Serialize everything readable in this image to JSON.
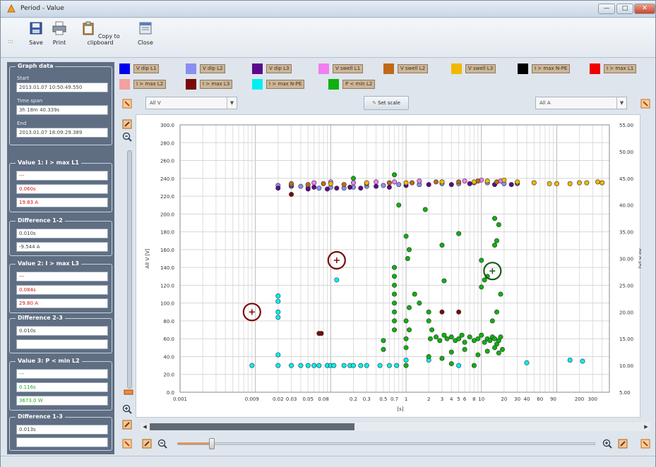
{
  "window": {
    "title": "Period - Value",
    "minimize_label": "—",
    "maximize_label": "□",
    "close_label": "✕"
  },
  "toolbar": {
    "save_label": "Save",
    "print_label": "Print",
    "copy_label": "Copy to clipboard",
    "close_label": "Close"
  },
  "graph_data": {
    "title": "Graph data",
    "start_caption": "Start",
    "start": "2013.01.07 10:50:49.550",
    "timespan_caption": "Time span",
    "timespan": "3h 18m 40.339s",
    "end_caption": "End",
    "end": "2013.01.07 18:09:29.389"
  },
  "value1": {
    "title": "Value 1: I > max L1",
    "v1": "---",
    "v2": "0.060s",
    "v3": "19.83 A"
  },
  "diff12": {
    "title": "Difference 1-2",
    "v1": "0.010s",
    "v2": "-9.544 A"
  },
  "value2": {
    "title": "Value 2: I > max L3",
    "v1": "---",
    "v2": "0.084s",
    "v3": "29.80 A"
  },
  "diff23": {
    "title": "Difference 2-3",
    "v1": "0.010s",
    "v2": ""
  },
  "value3": {
    "title": "Value 3: P < min L2",
    "v1": "---",
    "v2": "0.116s",
    "v3": "3673.0 W"
  },
  "diff13": {
    "title": "Difference 1-3",
    "v1": "0.013s",
    "v2": ""
  },
  "legend": [
    {
      "label": "V dip L1",
      "color": "#0000ee"
    },
    {
      "label": "V dip L2",
      "color": "#8a8ef0"
    },
    {
      "label": "V dip L3",
      "color": "#5a0a8a"
    },
    {
      "label": "V swell L1",
      "color": "#f07ef0"
    },
    {
      "label": "V swell L2",
      "color": "#c06a18"
    },
    {
      "label": "V swell L3",
      "color": "#f0b800"
    },
    {
      "label": "I > max N-PE",
      "color": "#000000"
    },
    {
      "label": "I > max L1",
      "color": "#ee0000"
    },
    {
      "label": "I > max L2",
      "color": "#f4a0a0"
    },
    {
      "label": "I > max L3",
      "color": "#7a0a0a"
    },
    {
      "label": "I > max N-PE",
      "color": "#00f0f0"
    },
    {
      "label": "P < min L2",
      "color": "#10b010"
    }
  ],
  "controls": {
    "left_select": "All V",
    "right_select": "All A",
    "set_scale_label": "Set scale"
  },
  "chart_data": {
    "type": "scatter",
    "xlabel": "[s]",
    "ylabel_left": "All V [V]",
    "ylabel_right": "All A [A]",
    "x_scale": "log",
    "xlim": [
      0.001,
      500
    ],
    "ylim_left": [
      0,
      300
    ],
    "ylim_right": [
      5,
      55
    ],
    "grid": true,
    "x_ticks": [
      "0.001",
      "0.009",
      "0.02",
      "0.03",
      "0.05",
      "0.08",
      "0.2",
      "0.3",
      "0.5",
      "0.7",
      "1",
      "2",
      "3",
      "4",
      "5",
      "6",
      "8",
      "10",
      "20",
      "30",
      "40",
      "60",
      "90",
      "200",
      "300"
    ],
    "x_tick_values": [
      0.001,
      0.009,
      0.02,
      0.03,
      0.05,
      0.08,
      0.2,
      0.3,
      0.5,
      0.7,
      1,
      2,
      3,
      4,
      5,
      6,
      8,
      10,
      20,
      30,
      40,
      60,
      90,
      200,
      300
    ],
    "y_left_ticks": [
      "0.0",
      "20.0",
      "40.0",
      "60.0",
      "80.0",
      "100.0",
      "120.0",
      "140.0",
      "160.0",
      "180.0",
      "200.0",
      "220.0",
      "240.0",
      "260.0",
      "280.0",
      "300.0"
    ],
    "y_left_tick_values": [
      0,
      20,
      40,
      60,
      80,
      100,
      120,
      140,
      160,
      180,
      200,
      220,
      240,
      260,
      280,
      300
    ],
    "y_right_ticks": [
      "5.00",
      "10.00",
      "15.00",
      "20.00",
      "25.00",
      "30.00",
      "35.00",
      "40.00",
      "45.00",
      "50.00",
      "55.00"
    ],
    "y_right_tick_values": [
      5,
      10,
      15,
      20,
      25,
      30,
      35,
      40,
      45,
      50,
      55
    ],
    "series": [
      {
        "name": "V dip L2",
        "color": "#8a8ef0",
        "axis": "left",
        "points": [
          [
            0.02,
            232
          ],
          [
            0.03,
            231
          ],
          [
            0.04,
            231
          ],
          [
            0.05,
            230
          ],
          [
            0.07,
            229
          ],
          [
            0.1,
            230
          ],
          [
            0.15,
            229
          ],
          [
            0.2,
            230
          ],
          [
            0.3,
            231
          ],
          [
            0.5,
            232
          ],
          [
            0.8,
            233
          ],
          [
            1.5,
            233
          ],
          [
            3,
            234
          ],
          [
            5,
            234
          ],
          [
            8,
            235
          ],
          [
            12,
            235
          ],
          [
            20,
            234
          ],
          [
            30,
            234
          ]
        ]
      },
      {
        "name": "V dip L3",
        "color": "#5a0a8a",
        "axis": "left",
        "points": [
          [
            0.02,
            229
          ],
          [
            0.03,
            232
          ],
          [
            0.05,
            228
          ],
          [
            0.06,
            230
          ],
          [
            0.09,
            228
          ],
          [
            0.12,
            229
          ],
          [
            0.18,
            230
          ],
          [
            0.25,
            229
          ],
          [
            0.4,
            231
          ],
          [
            0.6,
            230
          ],
          [
            1,
            232
          ],
          [
            2,
            233
          ],
          [
            4,
            233
          ],
          [
            7,
            234
          ],
          [
            15,
            233
          ],
          [
            25,
            233
          ]
        ]
      },
      {
        "name": "V swell L1",
        "color": "#f07ef0",
        "axis": "left",
        "points": [
          [
            0.03,
            233
          ],
          [
            0.06,
            235
          ],
          [
            0.1,
            236
          ],
          [
            0.2,
            235
          ],
          [
            0.4,
            236
          ],
          [
            0.7,
            236
          ],
          [
            1.5,
            237
          ],
          [
            3,
            236
          ],
          [
            6,
            237
          ],
          [
            10,
            238
          ],
          [
            18,
            237
          ]
        ]
      },
      {
        "name": "V swell L2",
        "color": "#c06a18",
        "axis": "left",
        "points": [
          [
            0.03,
            234
          ],
          [
            0.05,
            233
          ],
          [
            0.08,
            234
          ],
          [
            0.15,
            233
          ],
          [
            0.3,
            234
          ],
          [
            0.6,
            235
          ],
          [
            1.2,
            235
          ],
          [
            2.5,
            236
          ],
          [
            5,
            236
          ],
          [
            9,
            237
          ],
          [
            16,
            236
          ],
          [
            30,
            235
          ]
        ]
      },
      {
        "name": "V swell L3",
        "color": "#f0b800",
        "axis": "left",
        "points": [
          [
            0.1,
            234
          ],
          [
            0.3,
            235
          ],
          [
            1,
            235
          ],
          [
            3,
            236
          ],
          [
            8,
            236
          ],
          [
            12,
            237
          ],
          [
            20,
            238
          ],
          [
            30,
            236
          ],
          [
            50,
            235
          ],
          [
            80,
            234
          ],
          [
            100,
            234
          ],
          [
            150,
            234
          ],
          [
            200,
            235
          ],
          [
            250,
            235
          ],
          [
            350,
            236
          ],
          [
            400,
            235
          ]
        ]
      },
      {
        "name": "I > max N-PE",
        "color": "#00f0f0",
        "axis": "right",
        "points": [
          [
            0.009,
            10
          ],
          [
            0.02,
            10
          ],
          [
            0.02,
            12
          ],
          [
            0.02,
            20
          ],
          [
            0.02,
            22
          ],
          [
            0.02,
            19
          ],
          [
            0.02,
            23
          ],
          [
            0.03,
            10
          ],
          [
            0.04,
            10
          ],
          [
            0.05,
            10
          ],
          [
            0.06,
            10
          ],
          [
            0.07,
            10
          ],
          [
            0.09,
            10
          ],
          [
            0.1,
            10
          ],
          [
            0.11,
            10
          ],
          [
            0.12,
            26
          ],
          [
            0.15,
            10
          ],
          [
            0.18,
            10
          ],
          [
            0.2,
            10
          ],
          [
            0.25,
            10
          ],
          [
            0.3,
            10
          ],
          [
            0.45,
            10
          ],
          [
            0.6,
            10
          ],
          [
            0.75,
            10
          ],
          [
            1,
            11
          ],
          [
            2,
            11
          ],
          [
            5,
            10
          ],
          [
            40,
            10.5
          ],
          [
            150,
            11
          ],
          [
            220,
            10.8
          ]
        ]
      },
      {
        "name": "I > max L3",
        "color": "#7a0a0a",
        "axis": "right",
        "points": [
          [
            0.03,
            42
          ],
          [
            0.07,
            16
          ],
          [
            0.075,
            16
          ],
          [
            3,
            20
          ],
          [
            5,
            20
          ]
        ]
      },
      {
        "name": "P < min L2",
        "color": "#10b010",
        "axis": "left",
        "points": [
          [
            0.2,
            240
          ],
          [
            0.7,
            244
          ],
          [
            0.8,
            210
          ],
          [
            1.8,
            205
          ],
          [
            3,
            165
          ],
          [
            3.2,
            125
          ],
          [
            5,
            178
          ],
          [
            10,
            148
          ],
          [
            15,
            195
          ],
          [
            17,
            188
          ],
          [
            16,
            170
          ],
          [
            15,
            165
          ],
          [
            0.5,
            58
          ],
          [
            0.5,
            48
          ],
          [
            0.7,
            100
          ],
          [
            0.7,
            110
          ],
          [
            0.7,
            120
          ],
          [
            0.7,
            130
          ],
          [
            0.7,
            140
          ],
          [
            0.7,
            90
          ],
          [
            0.7,
            80
          ],
          [
            0.7,
            70
          ],
          [
            1,
            30
          ],
          [
            1,
            50
          ],
          [
            1,
            60
          ],
          [
            1.1,
            70
          ],
          [
            1,
            80
          ],
          [
            1.05,
            150
          ],
          [
            1.1,
            160
          ],
          [
            1,
            175
          ],
          [
            1.1,
            95
          ],
          [
            1.3,
            110
          ],
          [
            1.5,
            100
          ],
          [
            2,
            90
          ],
          [
            2,
            80
          ],
          [
            2.1,
            60
          ],
          [
            2.2,
            70
          ],
          [
            2.5,
            62
          ],
          [
            2.8,
            58
          ],
          [
            3.2,
            64
          ],
          [
            3.5,
            60
          ],
          [
            4,
            62
          ],
          [
            4.5,
            58
          ],
          [
            5,
            60
          ],
          [
            5.5,
            64
          ],
          [
            6,
            56
          ],
          [
            7,
            62
          ],
          [
            8,
            58
          ],
          [
            9,
            60
          ],
          [
            10,
            64
          ],
          [
            11,
            56
          ],
          [
            12,
            60
          ],
          [
            13,
            58
          ],
          [
            14,
            62
          ],
          [
            15,
            60
          ],
          [
            16,
            54
          ],
          [
            17,
            58
          ],
          [
            18,
            62
          ],
          [
            14,
            80
          ],
          [
            16,
            90
          ],
          [
            18,
            110
          ],
          [
            12,
            130
          ],
          [
            10,
            118
          ],
          [
            11,
            126
          ],
          [
            2,
            40
          ],
          [
            3,
            38
          ],
          [
            4,
            45
          ],
          [
            6,
            48
          ],
          [
            9,
            42
          ],
          [
            12,
            46
          ],
          [
            15,
            50
          ],
          [
            17,
            44
          ],
          [
            19,
            48
          ],
          [
            4,
            32
          ],
          [
            8,
            30
          ]
        ]
      }
    ],
    "annotations": [
      {
        "type": "cursor",
        "x": 0.009,
        "y": 90,
        "axis": "left",
        "color": "#7a0a0a",
        "label": "Value 1"
      },
      {
        "type": "cursor",
        "x": 0.12,
        "y": 148,
        "axis": "left",
        "color": "#7a0a0a",
        "label": "Value 2"
      },
      {
        "type": "cursor",
        "x": 14,
        "y": 136,
        "axis": "left",
        "color": "#1a5a1a",
        "label": "Value 3"
      }
    ]
  }
}
